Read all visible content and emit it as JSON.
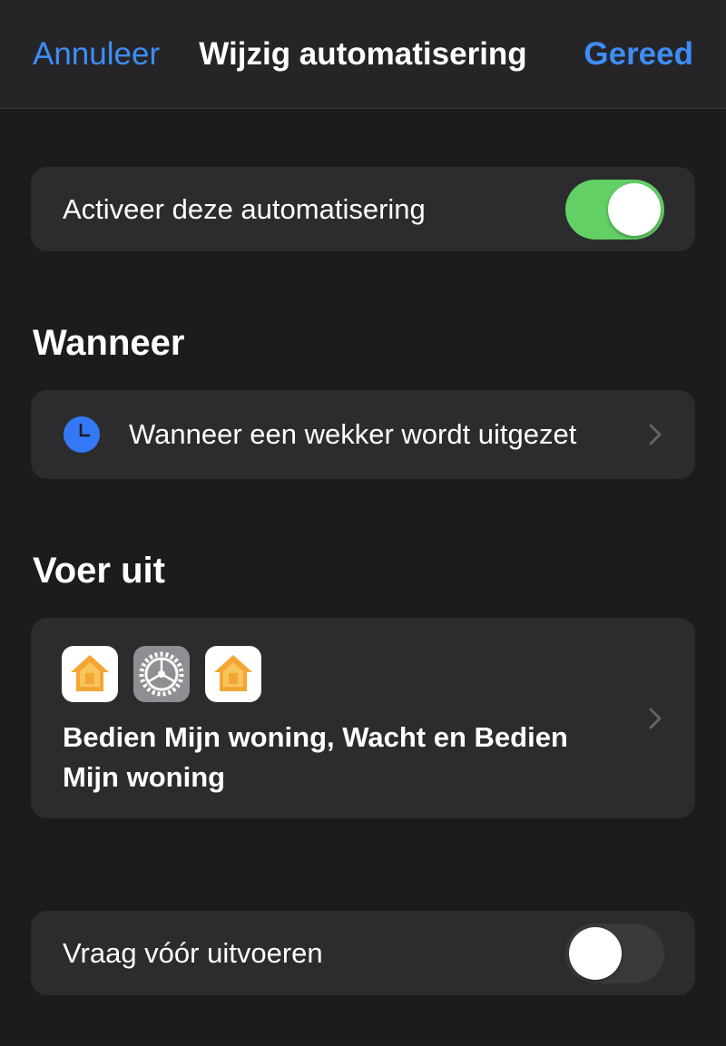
{
  "navbar": {
    "cancel_label": "Annuleer",
    "title": "Wijzig automatisering",
    "done_label": "Gereed"
  },
  "activate": {
    "label": "Activeer deze automatisering",
    "enabled": true
  },
  "when": {
    "header": "Wanneer",
    "trigger_label": "Wanneer een wekker wordt uitgezet",
    "icon": "clock-icon"
  },
  "do": {
    "header": "Voer uit",
    "icons": [
      "home-app-icon",
      "settings-app-icon",
      "home-app-icon"
    ],
    "summary": "Bedien Mijn woning, Wacht en Bedien Mijn woning"
  },
  "ask": {
    "label": "Vraag vóór uitvoeren",
    "enabled": false
  },
  "colors": {
    "background": "#1c1c1e",
    "card": "#2c2c2e",
    "accent": "#3d8df5",
    "toggle_on": "#63d066",
    "toggle_off": "#3a3a3c"
  }
}
